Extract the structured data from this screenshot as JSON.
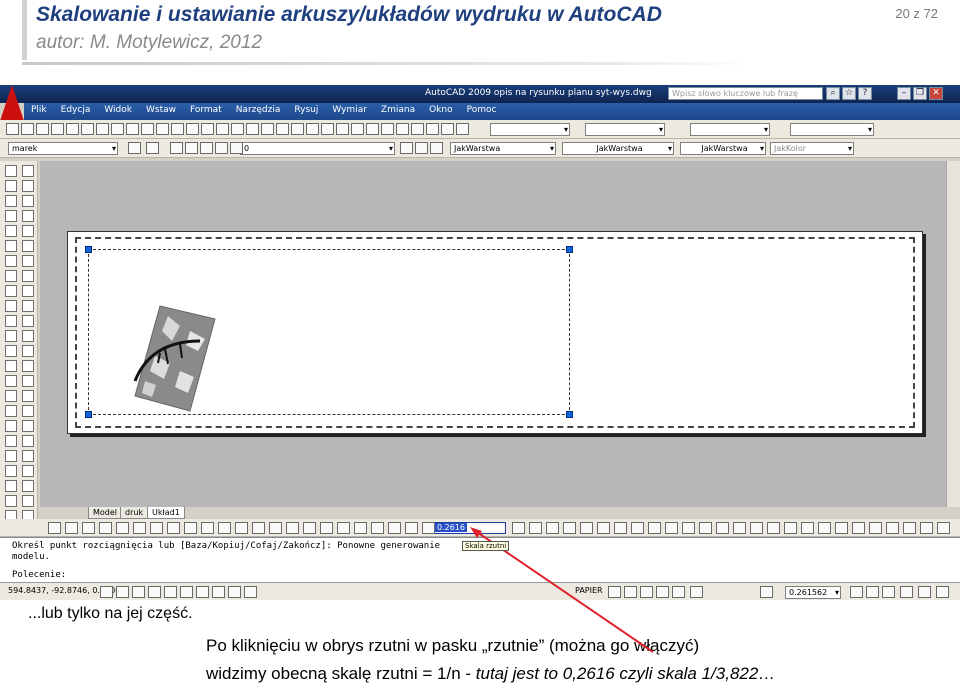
{
  "slide": {
    "title": "Skalowanie i ustawianie arkuszy/układów wydruku w AutoCAD",
    "author": "autor: M. Motylewicz, 2012",
    "page": "20 z 72",
    "caption1": "...lub tylko na jej część.",
    "caption2": "Po kliknięciu w obrys rzutni w pasku „rzutnie” (można go włączyć)",
    "caption3_plain": "widzimy obecną skalę rzutni = 1/n - ",
    "caption3_italic": "tutaj jest to  0,2616 czyli skala 1/3,822…",
    "arrow_color": "#e0202a"
  },
  "autocad": {
    "window_title": "AutoCAD 2009 opis na rysunku planu syt-wys.dwg",
    "search_placeholder": "Wpisz słowo kluczowe lub frazę",
    "menu": [
      "Plik",
      "Edycja",
      "Widok",
      "Wstaw",
      "Format",
      "Narzędzia",
      "Rysuj",
      "Wymiar",
      "Zmiana",
      "Okno",
      "Pomoc"
    ],
    "toolbar2": {
      "workspace": "marek",
      "layer": "0",
      "color": "JakWarstwa",
      "linetype": "JakWarstwa",
      "lineweight": "JakWarstwa",
      "plotstyle": "JakKolor"
    },
    "tabs": [
      "Model",
      "druk",
      "Układ1"
    ],
    "active_tab": "Układ1",
    "viewport_scale": "0.2616",
    "tooltip": "Skala rzutni",
    "command_lines": [
      "Określ punkt rozciągnięcia lub [Baza/Kopiuj/Cofaj/Zakończ]: Ponowne generowanie",
      "modelu.",
      "Polecenie:"
    ],
    "status": {
      "coords": "594.8437, -92.8746, 0.0000",
      "space": "PAPIER",
      "scale": "0.261562"
    },
    "accent_blue": "#1463d8"
  }
}
